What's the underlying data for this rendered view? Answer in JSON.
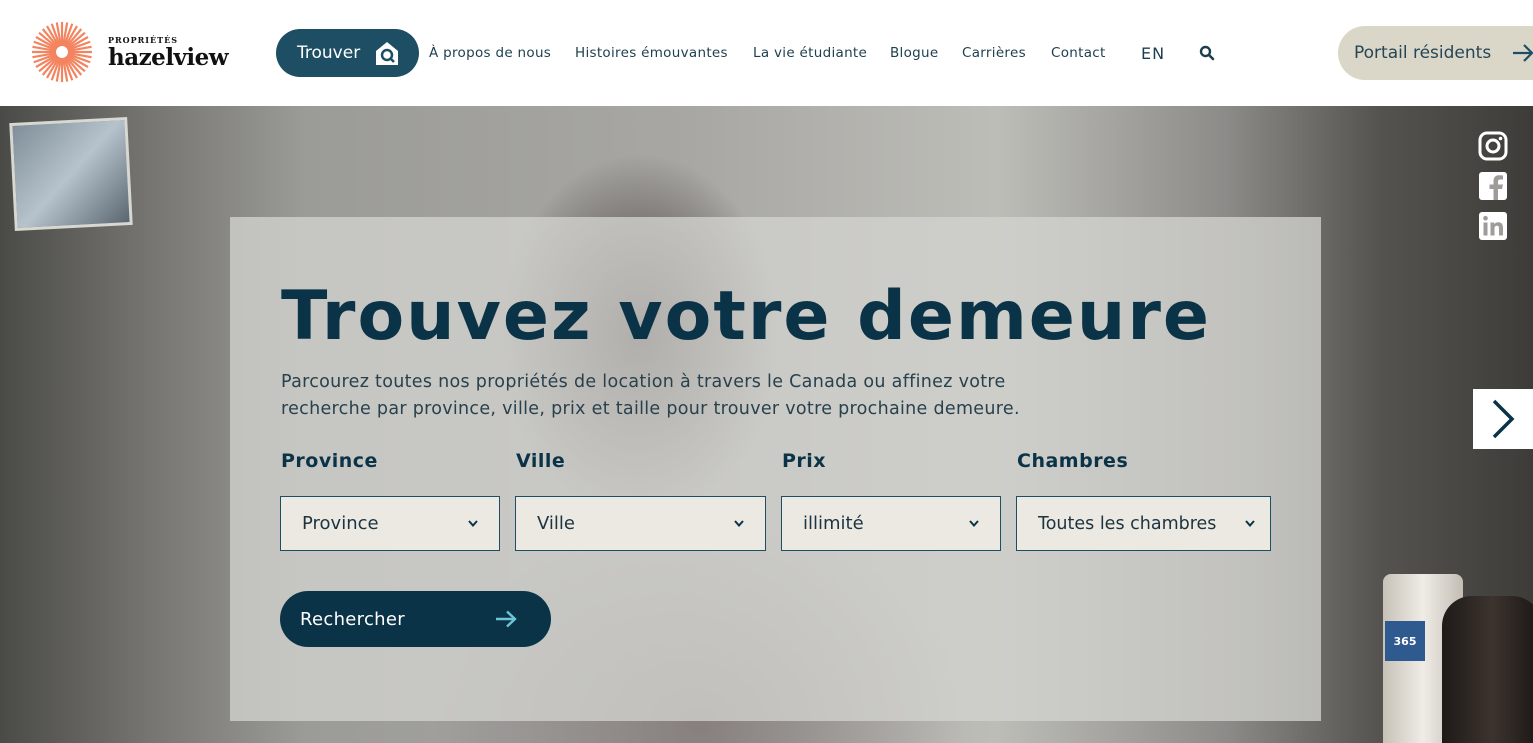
{
  "brand": {
    "small": "PROPRIÉTÉS",
    "name": "hazelview",
    "accent": "#f3845f"
  },
  "header": {
    "find_label": "Trouver",
    "nav": [
      {
        "label": "À propos de nous"
      },
      {
        "label": "Histoires émouvantes"
      },
      {
        "label": "La vie étudiante"
      },
      {
        "label": "Blogue"
      },
      {
        "label": "Carrières"
      },
      {
        "label": "Contact"
      }
    ],
    "lang": "EN",
    "portal_label": "Portail résidents",
    "colors": {
      "primary": "#1d4e64",
      "portal_bg": "#dad7c9"
    }
  },
  "hero": {
    "title": "Trouvez votre demeure",
    "description": "Parcourez toutes nos propriétés de location à travers le Canada ou affinez votre recherche par province, ville, prix et taille pour trouver votre prochaine demeure.",
    "filters": [
      {
        "label": "Province",
        "value": "Province"
      },
      {
        "label": "Ville",
        "value": "Ville"
      },
      {
        "label": "Prix",
        "value": "illimité"
      },
      {
        "label": "Chambres",
        "value": "Toutes les chambres"
      }
    ],
    "search_label": "Rechercher",
    "jar_label": "365"
  },
  "social": [
    "instagram-icon",
    "facebook-icon",
    "linkedin-icon"
  ]
}
